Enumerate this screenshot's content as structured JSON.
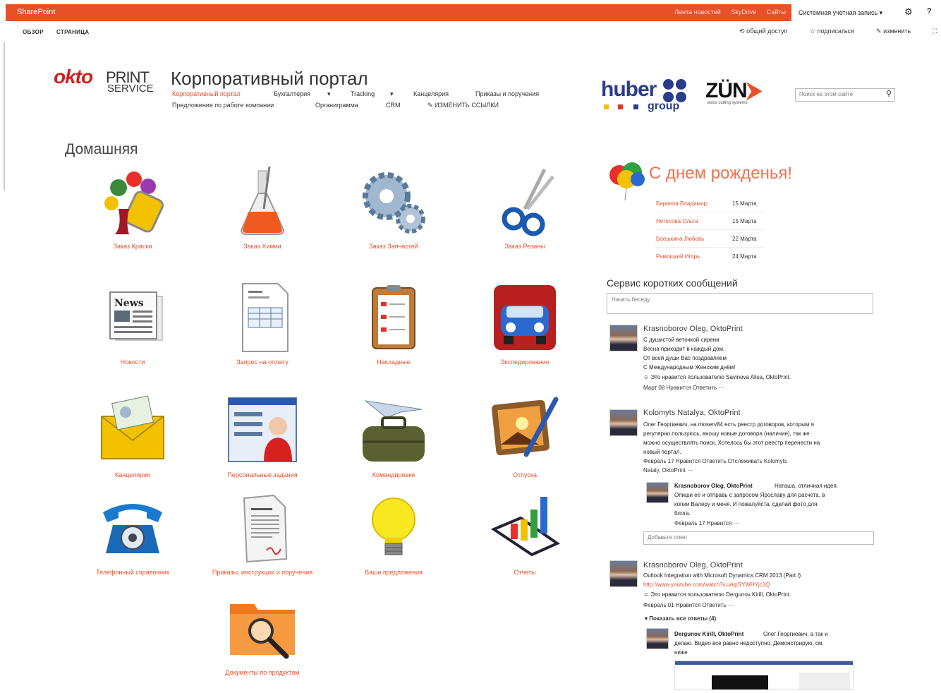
{
  "suitebar": {
    "brand": "SharePoint",
    "links": [
      "Лента новостей",
      "SkyDrive",
      "Сайты"
    ],
    "account": "Системная учетная запись ▾",
    "help": "?"
  },
  "ribbon": {
    "tabs": [
      "ОБЗОР",
      "СТРАНИЦА"
    ],
    "actions": [
      "общий доступ",
      "подписаться",
      "изменить"
    ]
  },
  "logo": {
    "okto": "okto",
    "print": "PRINT",
    "service": "SERVICE"
  },
  "site": {
    "title": "Корпоративный портал"
  },
  "nav": {
    "row1": [
      "Корпоративный портал",
      "Бухгалтерия",
      "Tracking",
      "Канцелярия",
      "Приказы и поручения"
    ],
    "row2": [
      "Предложения по работе компании",
      "Органиграмма",
      "CRM",
      "ИЗМЕНИТЬ ССЫЛКИ"
    ],
    "arrow": "▾"
  },
  "partners": {
    "huber": "huber",
    "huber_group": "group",
    "zund": "ZÜN",
    "zund_arrow": "⮞",
    "zund_sub": "swiss cutting systems"
  },
  "search": {
    "placeholder": "Поиск на этом сайте"
  },
  "page": {
    "title": "Домашняя"
  },
  "tiles": [
    {
      "label": "Заказ Краски",
      "icon": "paint-bucket-icon"
    },
    {
      "label": "Заказ Химии",
      "icon": "flask-icon"
    },
    {
      "label": "Заказ Запчастей",
      "icon": "gears-icon"
    },
    {
      "label": "Заказ Резины",
      "icon": "scissors-icon"
    },
    {
      "label": "Новости",
      "icon": "newspaper-icon"
    },
    {
      "label": "Запрос на оплату",
      "icon": "invoice-icon"
    },
    {
      "label": "Накладные",
      "icon": "clipboard-icon"
    },
    {
      "label": "Экспедирование",
      "icon": "truck-icon"
    },
    {
      "label": "Канцелярия",
      "icon": "envelope-icon"
    },
    {
      "label": "Персональные задания",
      "icon": "profile-card-icon"
    },
    {
      "label": "Командировки",
      "icon": "travel-bag-icon"
    },
    {
      "label": "Отпуска",
      "icon": "photo-brush-icon"
    },
    {
      "label": "Телефонный справочник",
      "icon": "telephone-icon"
    },
    {
      "label": "Приказы, инструкции и поручения",
      "icon": "document-icon"
    },
    {
      "label": "Ваши предложения",
      "icon": "light-bulb-icon"
    },
    {
      "label": "Отчеты",
      "icon": "bar-chart-icon"
    },
    {
      "label": "Документы по продуктам",
      "icon": "folder-search-icon"
    }
  ],
  "birthdays": {
    "title": "С днем рожденья!",
    "rows": [
      {
        "name": "Баринов Владимир",
        "date": "15 Марта"
      },
      {
        "name": "Нетесова Ольга",
        "date": "15 Марта"
      },
      {
        "name": "Баешкина Любовь",
        "date": "22 Марта"
      },
      {
        "name": "Рамощкий Игорь",
        "date": "24 Марта"
      }
    ]
  },
  "microblog": {
    "title": "Сервис коротких сообщений",
    "placeholder": "Начать беседу",
    "reply_placeholder": "Добавьте ответ",
    "posts": [
      {
        "author": "Krasnoborov Oleg, OktoPrint",
        "lines": [
          "С душистой веточкой сирени",
          "Весна приходит в каждый дом,",
          "От всей души Вас поздравляем",
          "С Международным Женским днём!",
          "☺ Это нравится пользователю Savinova Alisa, OktoPrint."
        ],
        "meta": "Март 08    Нравится    Ответить    ···"
      },
      {
        "author": "Kolomyts Natalya, OktoPrint",
        "lines": [
          "Олег Георгиевич, на moserv84 есть реестр договоров, которым я",
          "регулярно пользуюсь, вношу новые договора (наличие), так же",
          "можно осуществлять поиск. Хотелось бы этот реестр перенести на",
          "новый портал."
        ],
        "meta": "Февраль 17    Нравится    Ответить    Отслеживать Kolomyts",
        "meta2": "Nataly, OktoPrint    ···"
      },
      {
        "author": "Krasnoborov Oleg, OktoPrint",
        "lines": [
          "Наташа, отличная идея.",
          "Опиши ее и отправь с запросом Ярославу для расчета, в",
          "копии Валеру и меня. И пожалуйста, сделай фото для",
          "блога."
        ],
        "meta": "Февраль 17    Нравится    ···"
      },
      {
        "author": "Krasnoborov Oleg, OktoPrint",
        "lines": [
          "Outlook Integration with Microsoft Dynamics CRM 2013 (Part I)",
          "http://www.youtube.com/watch?v=xkpSYWHYjc1Q",
          "☺ Это нравится пользователю Dergunov Kirill, OktoPrint."
        ],
        "meta": "Февраль 01    Нравится    Ответить    ···",
        "show_all": "▾ Показать все ответы (4)"
      },
      {
        "author": "Dergunov Kirill, OktoPrint",
        "lines": [
          "Олег Георгиевич, а так и",
          "делаю. Видео все равно недоступно. Демонстрирую, см.",
          "ниже"
        ]
      }
    ]
  }
}
